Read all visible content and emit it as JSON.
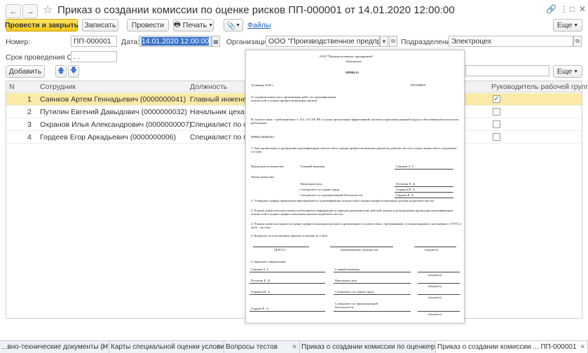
{
  "window": {
    "title": "Приказ о создании комиссии по оценке рисков ПП-000001 от 14.01.2020 12:00:00",
    "icons": [
      "link-icon",
      "more-icon",
      "maximize-icon",
      "close-icon"
    ]
  },
  "toolbar": {
    "post_close": "Провести и закрыть",
    "save": "Записать",
    "post": "Провести",
    "print": "Печать",
    "files": "Файлы",
    "more": "Еще"
  },
  "form": {
    "number_label": "Номер:",
    "number_value": "ПП-000001",
    "date_label": "Дата:",
    "date_value": "14.01.2020 12:00:00",
    "org_label": "Организация:",
    "org_value": "ООО \"Производственное предприятие\"",
    "dept_label": "Подразделение:",
    "dept_value": "Электроцех",
    "period_label": "Срок проведения ОПР:",
    "period_value": " .  .    "
  },
  "table_toolbar": {
    "add": "Добавить",
    "more": "Еще"
  },
  "table": {
    "columns": [
      "N",
      "Сотрудник",
      "Должность",
      "Руководитель рабочей группы"
    ],
    "rows": [
      {
        "n": "1",
        "employee": "Саянков Артем Геннадьевич (0000000041)",
        "position": "Главный инженер",
        "leader": "✓"
      },
      {
        "n": "2",
        "employee": "Путилин Евгений Давыдович (0000000032)",
        "position": "Начальник цеха",
        "leader": ""
      },
      {
        "n": "3",
        "employee": "Охранов Илья Александрович (0000000007)",
        "position": "Специалист по охр",
        "leader": ""
      },
      {
        "n": "4",
        "employee": "Гордеев Егор Аркадьевич (0000000006)",
        "position": "Специалист по пром",
        "leader": ""
      }
    ]
  },
  "preview": {
    "org": "ООО \"Производственное предприятие\"",
    "dept": "Электроцех",
    "doc_title": "ПРИКАЗ",
    "date": "14 января 2020 г.",
    "number": "ПП-000001",
    "subject": "О создании комиссии и организации работ по идентификации опасностей и оценке профессиональных рисков",
    "intro": "В соответствии с требованиями ст. 212, 214 ТК РФ, в целях организации эффективной системы управления охраной труда и обеспечения безопасности работников.",
    "order": "ПРИКАЗЫВАЮ:",
    "p1": "1. Для организации и проведения идентификации опасностей и оценки профессиональных рисков на рабочих местах создать комиссию в следующем составе:",
    "chair_label": "Председатель комиссии:",
    "chair_pos": "- Главный инженер",
    "chair_name": "Саянков А. Г.",
    "members_label": "Члены комиссии:",
    "members": [
      {
        "pos": "- Начальник цеха",
        "name": "Путилин Е. Д."
      },
      {
        "pos": "- Специалист по охране труда",
        "name": "Охранов И. А."
      },
      {
        "pos": "- Специалист по промышленной безопасности",
        "name": "Гордеев Е. А."
      }
    ],
    "p2": "2. Утвердить график проведения мероприятий по идентификации опасностей и оценки профессиональных рисков на рабочих местах.",
    "p3": "3. Членам комиссии подготовить необходимую информацию и передать руководителю рабочей группы для проведения процедуры идентификации опасностей и оценки профессиональных рисков на рабочих местах.",
    "p4": "4. Членам комиссии провести оценку профессиональных рисков в организации в соответствии с требованиями, установленными в положении о СУОТ, в срок – до  года.",
    "p5": "5. Контроль за исполнением приказа оставляю за собой",
    "sig_fio": "(Ф.И.О.)",
    "sig_pos": "(наименование должности)",
    "sig_sign": "(подпись)",
    "acquainted": "С приказом ознакомлены:",
    "ack": [
      {
        "name": "Саянков А. Г.",
        "pos": "Главный инженер",
        "sign": "(подпись)"
      },
      {
        "name": "Путилин Е. Д.",
        "pos": "Начальник цеха",
        "sign": "(подпись)"
      },
      {
        "name": "Охранов И. А.",
        "pos": "Специалист по охране труда",
        "sign": "(подпись)"
      },
      {
        "name": "Гордеев Е. А.",
        "pos": "Специалист по промышленной безопасности",
        "sign": "(подпись)"
      }
    ]
  },
  "tabs": [
    {
      "label": "...вно-технические документы (НТД)"
    },
    {
      "label": "Карты специальной оценки условий труда"
    },
    {
      "label": "Вопросы тестов"
    },
    {
      "label": "Приказ о создании комиссии по оценке р..."
    },
    {
      "label": "Приказ о создании комиссии ... ПП-000001"
    }
  ]
}
